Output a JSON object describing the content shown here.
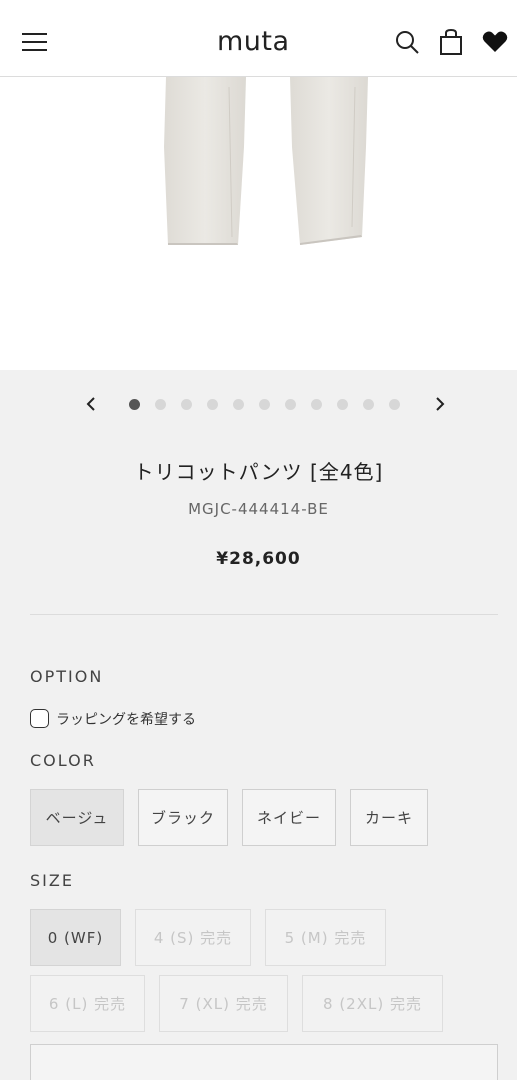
{
  "header": {
    "logo": "muta",
    "icons": [
      "menu-icon",
      "search-icon",
      "shopping-bag-icon",
      "heart-icon"
    ]
  },
  "carousel": {
    "prev_icon": "chevron-left-icon",
    "next_icon": "chevron-right-icon",
    "total_slides": 11,
    "active_slide": 1
  },
  "product": {
    "title": "トリコットパンツ [全4色]",
    "sku": "MGJC-444414-BE",
    "price": "¥28,600"
  },
  "option": {
    "label": "OPTION",
    "wrapping_label": "ラッピングを希望する",
    "wrapping_checked": false
  },
  "color": {
    "label": "COLOR",
    "options": [
      "ベージュ",
      "ブラック",
      "ネイビー",
      "カーキ"
    ],
    "selected": "ベージュ"
  },
  "size": {
    "label": "SIZE",
    "options": [
      "0 (WF)",
      "4 (S) 完売",
      "5 (M) 完売",
      "6 (L) 完売",
      "7 (XL) 完売",
      "8 (2XL) 完売"
    ],
    "selected": "0 (WF)"
  },
  "colors": {
    "background": "#f1f1f1",
    "text": "#333333",
    "soldout_text": "#c6c6c6",
    "selected_chip": "#e4e4e4"
  }
}
